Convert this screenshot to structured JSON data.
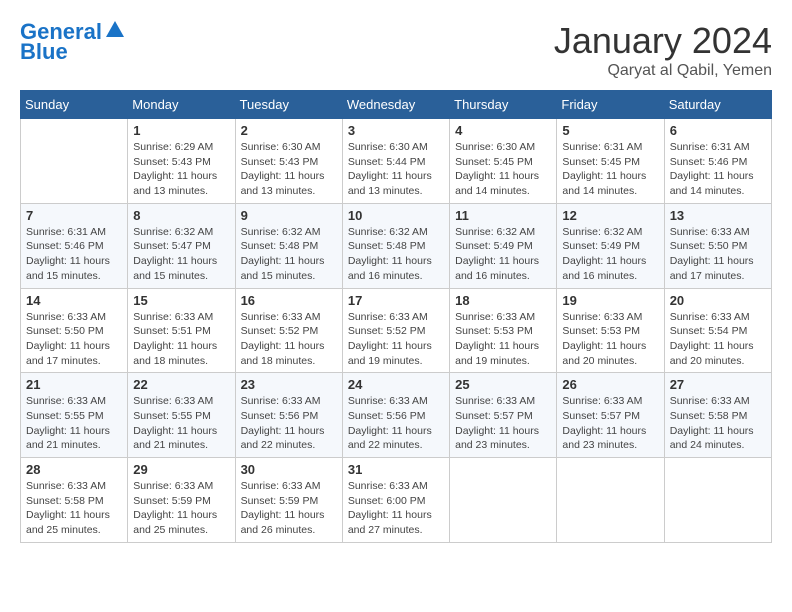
{
  "header": {
    "logo_line1": "General",
    "logo_line2": "Blue",
    "month": "January 2024",
    "location": "Qaryat al Qabil, Yemen"
  },
  "days_of_week": [
    "Sunday",
    "Monday",
    "Tuesday",
    "Wednesday",
    "Thursday",
    "Friday",
    "Saturday"
  ],
  "weeks": [
    [
      {
        "day": "",
        "info": ""
      },
      {
        "day": "1",
        "info": "Sunrise: 6:29 AM\nSunset: 5:43 PM\nDaylight: 11 hours\nand 13 minutes."
      },
      {
        "day": "2",
        "info": "Sunrise: 6:30 AM\nSunset: 5:43 PM\nDaylight: 11 hours\nand 13 minutes."
      },
      {
        "day": "3",
        "info": "Sunrise: 6:30 AM\nSunset: 5:44 PM\nDaylight: 11 hours\nand 13 minutes."
      },
      {
        "day": "4",
        "info": "Sunrise: 6:30 AM\nSunset: 5:45 PM\nDaylight: 11 hours\nand 14 minutes."
      },
      {
        "day": "5",
        "info": "Sunrise: 6:31 AM\nSunset: 5:45 PM\nDaylight: 11 hours\nand 14 minutes."
      },
      {
        "day": "6",
        "info": "Sunrise: 6:31 AM\nSunset: 5:46 PM\nDaylight: 11 hours\nand 14 minutes."
      }
    ],
    [
      {
        "day": "7",
        "info": "Sunrise: 6:31 AM\nSunset: 5:46 PM\nDaylight: 11 hours\nand 15 minutes."
      },
      {
        "day": "8",
        "info": "Sunrise: 6:32 AM\nSunset: 5:47 PM\nDaylight: 11 hours\nand 15 minutes."
      },
      {
        "day": "9",
        "info": "Sunrise: 6:32 AM\nSunset: 5:48 PM\nDaylight: 11 hours\nand 15 minutes."
      },
      {
        "day": "10",
        "info": "Sunrise: 6:32 AM\nSunset: 5:48 PM\nDaylight: 11 hours\nand 16 minutes."
      },
      {
        "day": "11",
        "info": "Sunrise: 6:32 AM\nSunset: 5:49 PM\nDaylight: 11 hours\nand 16 minutes."
      },
      {
        "day": "12",
        "info": "Sunrise: 6:32 AM\nSunset: 5:49 PM\nDaylight: 11 hours\nand 16 minutes."
      },
      {
        "day": "13",
        "info": "Sunrise: 6:33 AM\nSunset: 5:50 PM\nDaylight: 11 hours\nand 17 minutes."
      }
    ],
    [
      {
        "day": "14",
        "info": "Sunrise: 6:33 AM\nSunset: 5:50 PM\nDaylight: 11 hours\nand 17 minutes."
      },
      {
        "day": "15",
        "info": "Sunrise: 6:33 AM\nSunset: 5:51 PM\nDaylight: 11 hours\nand 18 minutes."
      },
      {
        "day": "16",
        "info": "Sunrise: 6:33 AM\nSunset: 5:52 PM\nDaylight: 11 hours\nand 18 minutes."
      },
      {
        "day": "17",
        "info": "Sunrise: 6:33 AM\nSunset: 5:52 PM\nDaylight: 11 hours\nand 19 minutes."
      },
      {
        "day": "18",
        "info": "Sunrise: 6:33 AM\nSunset: 5:53 PM\nDaylight: 11 hours\nand 19 minutes."
      },
      {
        "day": "19",
        "info": "Sunrise: 6:33 AM\nSunset: 5:53 PM\nDaylight: 11 hours\nand 20 minutes."
      },
      {
        "day": "20",
        "info": "Sunrise: 6:33 AM\nSunset: 5:54 PM\nDaylight: 11 hours\nand 20 minutes."
      }
    ],
    [
      {
        "day": "21",
        "info": "Sunrise: 6:33 AM\nSunset: 5:55 PM\nDaylight: 11 hours\nand 21 minutes."
      },
      {
        "day": "22",
        "info": "Sunrise: 6:33 AM\nSunset: 5:55 PM\nDaylight: 11 hours\nand 21 minutes."
      },
      {
        "day": "23",
        "info": "Sunrise: 6:33 AM\nSunset: 5:56 PM\nDaylight: 11 hours\nand 22 minutes."
      },
      {
        "day": "24",
        "info": "Sunrise: 6:33 AM\nSunset: 5:56 PM\nDaylight: 11 hours\nand 22 minutes."
      },
      {
        "day": "25",
        "info": "Sunrise: 6:33 AM\nSunset: 5:57 PM\nDaylight: 11 hours\nand 23 minutes."
      },
      {
        "day": "26",
        "info": "Sunrise: 6:33 AM\nSunset: 5:57 PM\nDaylight: 11 hours\nand 23 minutes."
      },
      {
        "day": "27",
        "info": "Sunrise: 6:33 AM\nSunset: 5:58 PM\nDaylight: 11 hours\nand 24 minutes."
      }
    ],
    [
      {
        "day": "28",
        "info": "Sunrise: 6:33 AM\nSunset: 5:58 PM\nDaylight: 11 hours\nand 25 minutes."
      },
      {
        "day": "29",
        "info": "Sunrise: 6:33 AM\nSunset: 5:59 PM\nDaylight: 11 hours\nand 25 minutes."
      },
      {
        "day": "30",
        "info": "Sunrise: 6:33 AM\nSunset: 5:59 PM\nDaylight: 11 hours\nand 26 minutes."
      },
      {
        "day": "31",
        "info": "Sunrise: 6:33 AM\nSunset: 6:00 PM\nDaylight: 11 hours\nand 27 minutes."
      },
      {
        "day": "",
        "info": ""
      },
      {
        "day": "",
        "info": ""
      },
      {
        "day": "",
        "info": ""
      }
    ]
  ]
}
